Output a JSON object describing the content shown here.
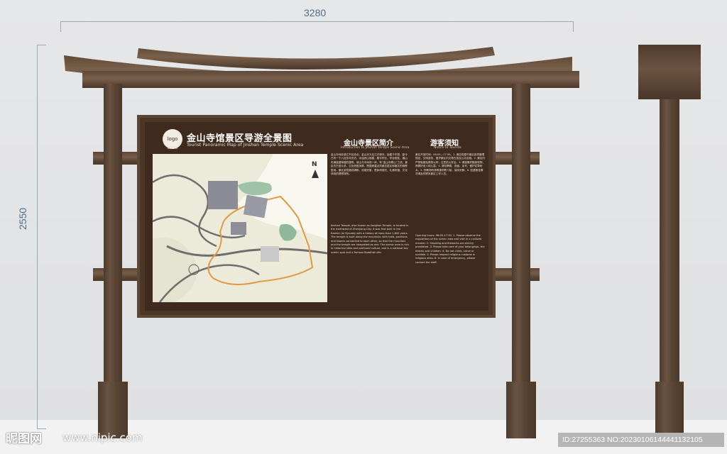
{
  "dimensions": {
    "width_label": "3280",
    "height_label": "2550"
  },
  "logo": {
    "text": "logo",
    "sub": "LOGO"
  },
  "sign": {
    "title_cn": "金山寺馆景区导游全景图",
    "title_en": "Tourist Panoramic Map of Jinshan Temple Scenic Area"
  },
  "map": {
    "compass": "N"
  },
  "intro": {
    "title": "金山寺景区简介",
    "title_en": "Introduction to Jinshan Temple Scenic Area",
    "text_cn": "金山寺地处镇江市区西北，金山寺又名江天禅寺，始建于东晋，距今已有一千六百多年历史。寺庙依山而建，殿宇栉比，亭台相连，遍山布满金碧辉煌的建筑，使山与寺浑然一体，有“金山寺裹山”之说。景区内古迹众多，文化底蕴深厚，是国家重点风景名胜区和著名的佛教胜地。景区游览路线清晰，设施完善，是休闲观光、礼佛祈福、文化体验的理想场所。",
    "text_en": "Jinshan Temple, also known as Jiangtian Temple, is located in the northwest of Zhenjiang City. It was first built in the Eastern Jin Dynasty with a history of more than 1,600 years. The temple is built along the mountain, with halls, pavilions and towers connected to each other, so that the mountain and the temple are integrated as one. The scenic area is rich in historical sites and profound culture, and is a national key scenic spot and a famous Buddhist site."
  },
  "notice": {
    "title": "游客须知",
    "title_en": "Notice to Tourists",
    "text_cn": "景区开放时间：08:00—17:30。1. 请自觉遵守景区各项管理规定，文明游览，爱护景区内文物古迹及公共设施。2. 景区内严禁吸烟及携带火种，注意防火安全。3. 请保管好随身财物，照看好老人和儿童。4. 请勿攀爬、刻画、涂写，爱护花草树木。5. 宗教场所请尊重宗教习俗，保持安静。6. 如遇紧急情况请及时联系景区工作人员。",
    "text_en": "Opening hours: 08:00-17:30. 1. Please observe the regulations of the scenic area and visit in a civilized manner. 2. Smoking and fireworks are strictly prohibited. 3. Please take care of your belongings, the elderly and children. 4. Do not climb, carve or scribble. 5. Please respect religious customs in religious sites. 6. In case of emergency, please contact the staff."
  },
  "watermark": {
    "site_cn": "昵图网",
    "site_url": "www.nipic.com",
    "id_text": "ID:27255363 NO:20230106144441132105"
  }
}
